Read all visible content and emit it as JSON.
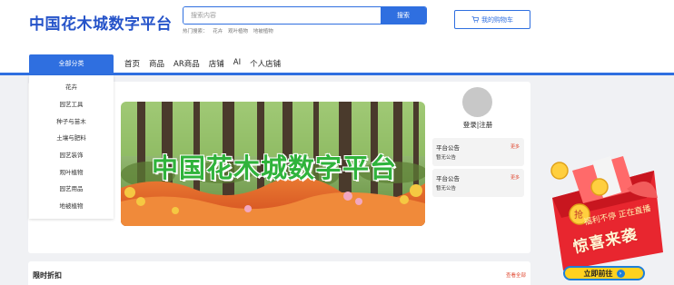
{
  "header": {
    "logo": "中国花木城数字平台",
    "search_placeholder": "搜索内容",
    "search_button": "搜索",
    "hot_label": "热门搜索：",
    "hot_terms": [
      "花卉",
      "观叶植物",
      "地被植物"
    ],
    "cart_label": "我的购物车"
  },
  "nav": {
    "all_categories": "全部分类",
    "items": [
      "首页",
      "商品",
      "AR商品",
      "店铺",
      "AI",
      "个人店铺"
    ]
  },
  "categories": [
    "花卉",
    "园艺工具",
    "种子与苗木",
    "土壤与肥料",
    "园艺装饰",
    "观叶植物",
    "园艺用品",
    "地被植物"
  ],
  "banner": {
    "title": "中国花木城数字平台"
  },
  "user_panel": {
    "login_label": "登录|注册",
    "notices": [
      {
        "title": "平台公告",
        "more": "更多",
        "body": "暂无公告"
      },
      {
        "title": "平台公告",
        "more": "更多",
        "body": "暂无公告"
      }
    ]
  },
  "flash_sale": {
    "title": "限时折扣",
    "more": "查看全部"
  },
  "promo": {
    "line1": "福利不停 正在直播",
    "line2": "惊喜来袭",
    "button": "立即前往"
  },
  "colors": {
    "primary": "#2f6fe0",
    "logo": "#2553c9",
    "more_link": "#e0472f",
    "banner_text": "#2fb33b",
    "promo_red": "#e8262f",
    "promo_button": "#ffd21f"
  }
}
